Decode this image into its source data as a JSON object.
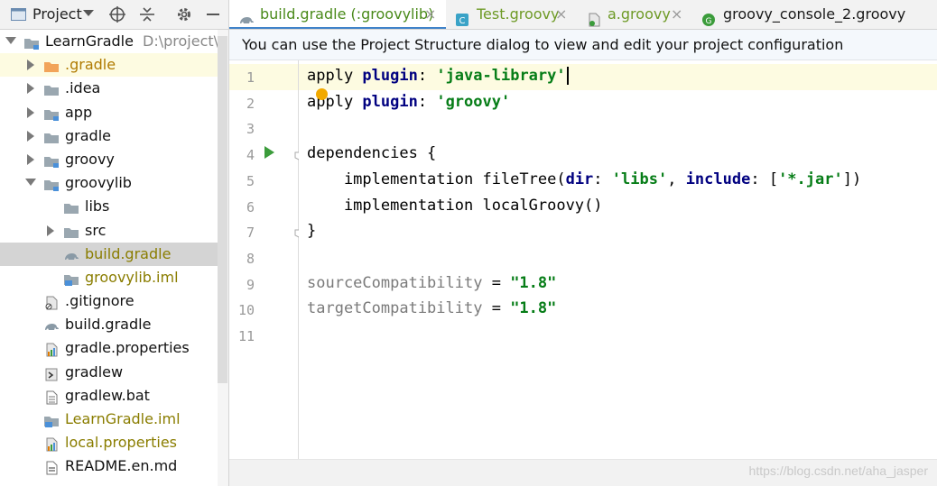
{
  "project_panel": {
    "title": "Project",
    "toolbar_icons": [
      "locate-icon",
      "collapse-icon",
      "gear-icon",
      "minimize-icon"
    ],
    "tree": [
      {
        "label": "LearnGradle",
        "path": "D:\\project\\And",
        "icon": "module-folder-icon",
        "level": 0,
        "expanded": true
      },
      {
        "label": ".gradle",
        "icon": "folder-orange-icon",
        "level": 1,
        "expanded": false,
        "highlight": "yellow"
      },
      {
        "label": ".idea",
        "icon": "folder-icon",
        "level": 1,
        "expanded": false
      },
      {
        "label": "app",
        "icon": "module-folder-icon",
        "level": 1,
        "expanded": false
      },
      {
        "label": "gradle",
        "icon": "folder-icon",
        "level": 1,
        "expanded": false
      },
      {
        "label": "groovy",
        "icon": "module-folder-icon",
        "level": 1,
        "expanded": false
      },
      {
        "label": "groovylib",
        "icon": "module-folder-icon",
        "level": 1,
        "expanded": true
      },
      {
        "label": "libs",
        "icon": "folder-icon",
        "level": 2
      },
      {
        "label": "src",
        "icon": "folder-icon",
        "level": 2,
        "expanded": false
      },
      {
        "label": "build.gradle",
        "icon": "gradle-icon",
        "level": 2,
        "selected": true
      },
      {
        "label": "groovylib.iml",
        "icon": "iml-icon",
        "level": 2
      },
      {
        "label": ".gitignore",
        "icon": "gitignore-icon",
        "level": 1
      },
      {
        "label": "build.gradle",
        "icon": "gradle-icon",
        "level": 1
      },
      {
        "label": "gradle.properties",
        "icon": "properties-icon",
        "level": 1
      },
      {
        "label": "gradlew",
        "icon": "script-icon",
        "level": 1
      },
      {
        "label": "gradlew.bat",
        "icon": "text-file-icon",
        "level": 1
      },
      {
        "label": "LearnGradle.iml",
        "icon": "iml-icon",
        "level": 1
      },
      {
        "label": "local.properties",
        "icon": "properties-icon",
        "level": 1
      },
      {
        "label": "README.en.md",
        "icon": "markdown-icon",
        "level": 1
      }
    ]
  },
  "tabs": [
    {
      "label": "build.gradle (:groovylib)",
      "icon": "gradle-icon",
      "active": true
    },
    {
      "label": "Test.groovy",
      "icon": "groovy-class-icon",
      "active": false
    },
    {
      "label": "a.groovy",
      "icon": "groovy-script-icon",
      "active": false
    },
    {
      "label": "groovy_console_2.groovy",
      "icon": "groovy-g-icon",
      "active": false
    }
  ],
  "tab_close_glyph": "×",
  "banner": {
    "text": "You can use the Project Structure dialog to view and edit your project configuration"
  },
  "editor": {
    "line_numbers": [
      "1",
      "2",
      "3",
      "4",
      "5",
      "6",
      "7",
      "8",
      "9",
      "10",
      "11"
    ],
    "current_line": 1,
    "lines": [
      [
        {
          "t": "apply ",
          "c": "p"
        },
        {
          "t": "plugin",
          "c": "kw"
        },
        {
          "t": ": ",
          "c": "p"
        },
        {
          "t": "'java-library'",
          "c": "str"
        }
      ],
      [
        {
          "t": "apply ",
          "c": "p"
        },
        {
          "t": "plugin",
          "c": "kw"
        },
        {
          "t": ": ",
          "c": "p"
        },
        {
          "t": "'groovy'",
          "c": "str"
        }
      ],
      [],
      [
        {
          "t": "dependencies {",
          "c": "p"
        }
      ],
      [
        {
          "t": "    implementation fileTree(",
          "c": "p"
        },
        {
          "t": "dir",
          "c": "kw"
        },
        {
          "t": ": ",
          "c": "p"
        },
        {
          "t": "'libs'",
          "c": "str"
        },
        {
          "t": ", ",
          "c": "p"
        },
        {
          "t": "include",
          "c": "kw"
        },
        {
          "t": ": [",
          "c": "p"
        },
        {
          "t": "'*.jar'",
          "c": "str"
        },
        {
          "t": "])",
          "c": "p"
        }
      ],
      [
        {
          "t": "    implementation localGroovy()",
          "c": "p"
        }
      ],
      [
        {
          "t": "}",
          "c": "p"
        }
      ],
      [],
      [
        {
          "t": "sourceCompatibility",
          "c": "prop"
        },
        {
          "t": " = ",
          "c": "p"
        },
        {
          "t": "\"1.8\"",
          "c": "str"
        }
      ],
      [
        {
          "t": "targetCompatibility",
          "c": "prop"
        },
        {
          "t": " = ",
          "c": "p"
        },
        {
          "t": "\"1.8\"",
          "c": "str"
        }
      ],
      []
    ]
  },
  "watermark": "https://blog.csdn.net/aha_jasper",
  "colors": {
    "accent": "#4083c9",
    "keyword": "#000080",
    "string": "#067d17",
    "selection": "#d4d4d4",
    "current_line": "#fdfbe1"
  }
}
